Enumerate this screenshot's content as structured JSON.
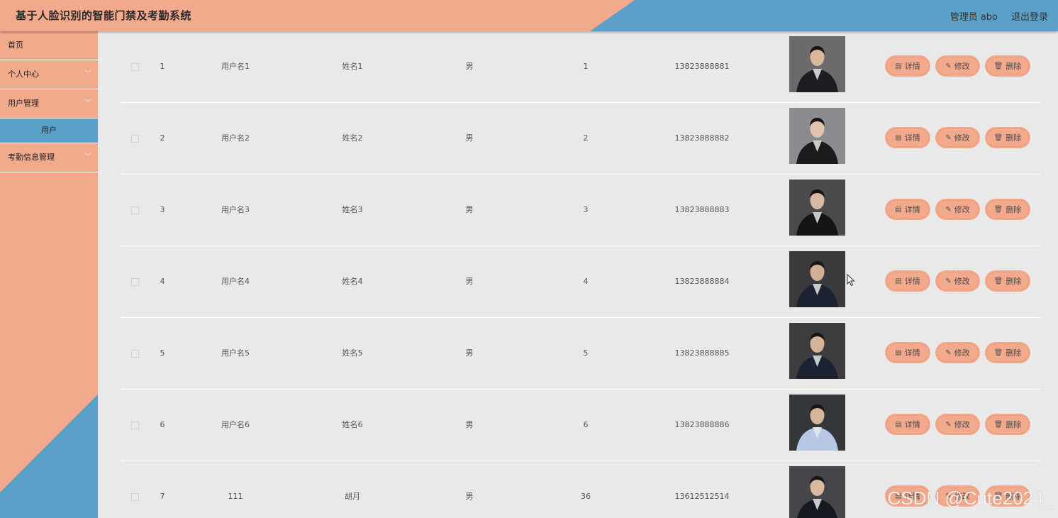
{
  "header": {
    "title": "基于人脸识别的智能门禁及考勤系统",
    "user_label": "管理员 abo",
    "logout_label": "退出登录",
    "colors": {
      "salmon": "#f3a98b",
      "blue": "#5aa0c8"
    }
  },
  "sidebar": {
    "items": [
      {
        "label": "首页",
        "chevron": ""
      },
      {
        "label": "个人中心",
        "chevron": "﹀"
      },
      {
        "label": "用户管理",
        "chevron": "﹀"
      },
      {
        "label": "用户",
        "chevron": ""
      },
      {
        "label": "考勤信息管理",
        "chevron": "﹀"
      }
    ]
  },
  "table": {
    "rows": [
      {
        "index": "1",
        "username": "用户名1",
        "name": "姓名1",
        "gender": "男",
        "age": "1",
        "phone": "13823888881"
      },
      {
        "index": "2",
        "username": "用户名2",
        "name": "姓名2",
        "gender": "男",
        "age": "2",
        "phone": "13823888882"
      },
      {
        "index": "3",
        "username": "用户名3",
        "name": "姓名3",
        "gender": "男",
        "age": "3",
        "phone": "13823888883"
      },
      {
        "index": "4",
        "username": "用户名4",
        "name": "姓名4",
        "gender": "男",
        "age": "4",
        "phone": "13823888884"
      },
      {
        "index": "5",
        "username": "用户名5",
        "name": "姓名5",
        "gender": "男",
        "age": "5",
        "phone": "13823888885"
      },
      {
        "index": "6",
        "username": "用户名6",
        "name": "姓名6",
        "gender": "男",
        "age": "6",
        "phone": "13823888886"
      },
      {
        "index": "7",
        "username": "111",
        "name": "胡月",
        "gender": "男",
        "age": "36",
        "phone": "13612512514"
      }
    ],
    "actions": {
      "detail": "详情",
      "edit": "修改",
      "delete": "删除"
    },
    "icons": {
      "detail": "document-icon",
      "edit": "pencil-icon",
      "delete": "trash-icon"
    }
  },
  "watermark": "CSDN @Cute2024_"
}
